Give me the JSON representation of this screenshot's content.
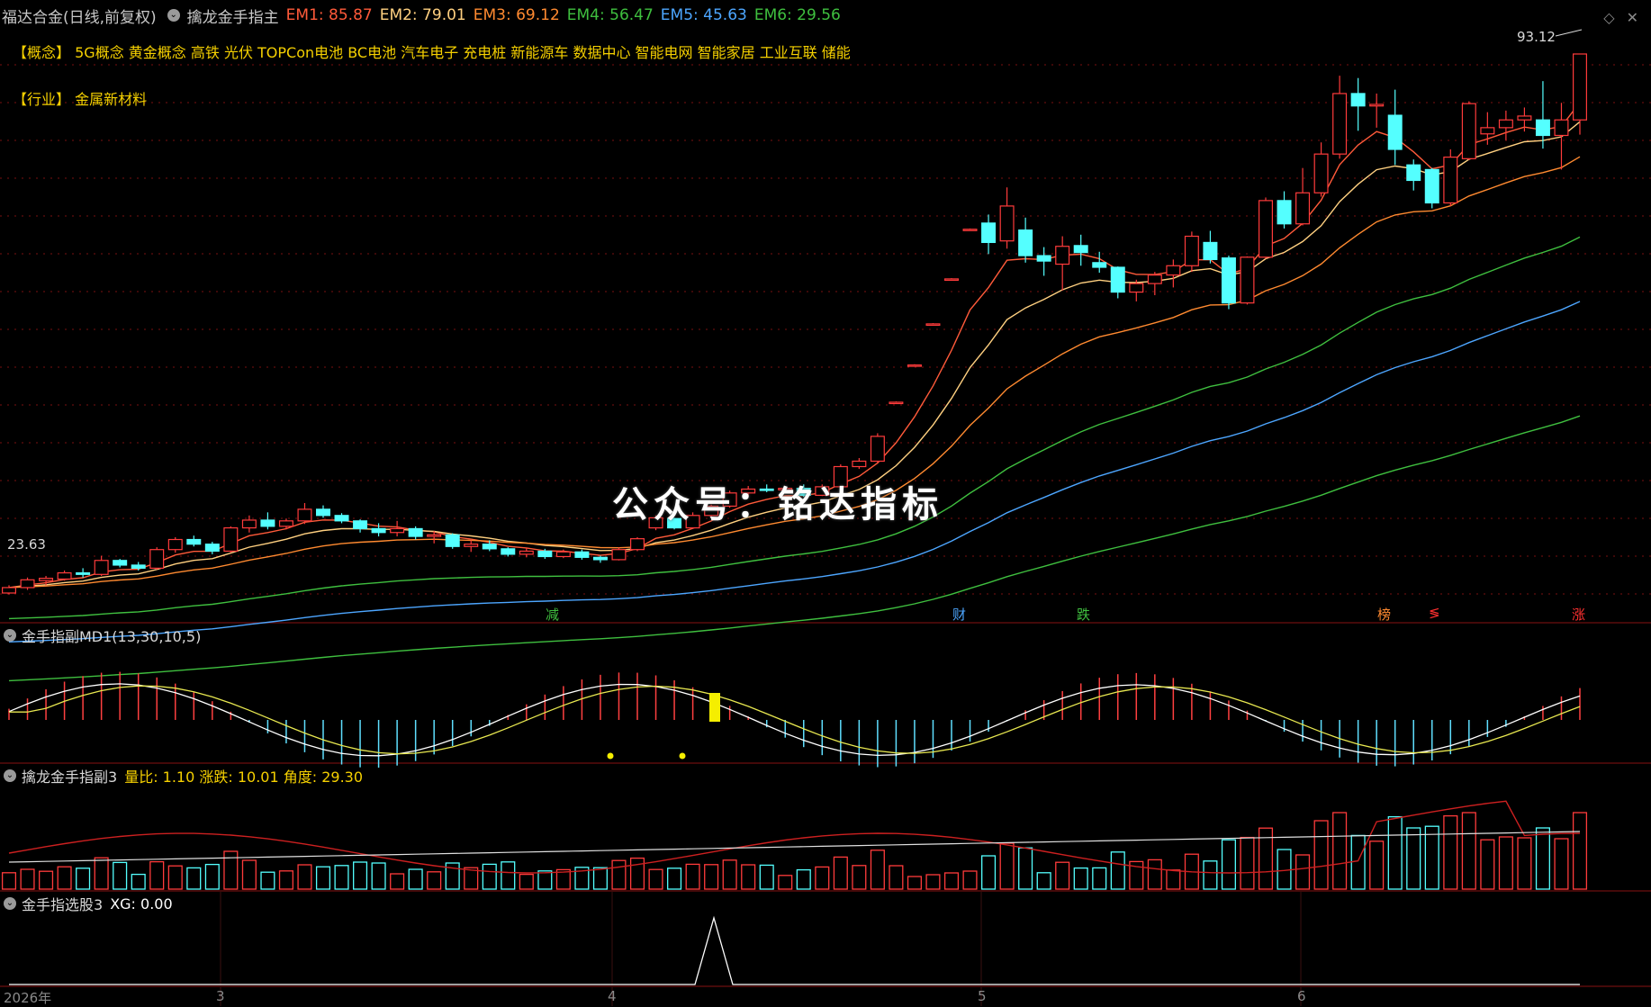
{
  "header": {
    "title": "福达合金(日线,前复权)",
    "indicator_name": "擒龙金手指主",
    "ema": [
      {
        "label": "EM1: 85.87",
        "color": "#ff5a3a"
      },
      {
        "label": "EM2: 79.01",
        "color": "#ffd080"
      },
      {
        "label": "EM3: 69.12",
        "color": "#ff8a30"
      },
      {
        "label": "EM4: 56.47",
        "color": "#3fbf3f"
      },
      {
        "label": "EM5: 45.63",
        "color": "#4da6ff"
      },
      {
        "label": "EM6: 29.56",
        "color": "#3fbf3f"
      }
    ]
  },
  "tags": {
    "concept_label": "【概念】",
    "concept_text": "5G概念 黄金概念 高铁 光伏 TOPCon电池 BC电池 汽车电子 充电桩 新能源车 数据中心 智能电网 智能家居 工业互联 储能",
    "industry_label": "【行业】",
    "industry_text": "金属新材料"
  },
  "watermark": "公众号：铭达指标",
  "panels": {
    "md1_label": "金手指副MD1(13,30,10,5)",
    "sub3_label": "擒龙金手指副3",
    "sub3_values": "量比: 1.10  涨跌: 10.01  角度: 29.30",
    "sel3_label": "金手指选股3",
    "sel3_values": "XG: 0.00"
  },
  "events": [
    {
      "text": "减",
      "color": "#3fbf3f"
    },
    {
      "text": "财",
      "color": "#4da6ff"
    },
    {
      "text": "跌",
      "color": "#3fbf3f"
    },
    {
      "text": "榜",
      "color": "#ff8a30"
    },
    {
      "text": "≶",
      "color": "#ff3030"
    },
    {
      "text": "涨",
      "color": "#ff3030"
    }
  ],
  "axis": {
    "dates": [
      "2026年",
      "3",
      "4",
      "5",
      "6"
    ]
  },
  "colors": {
    "up": "#ff3b3b",
    "down": "#54ffff",
    "grid": "#7a1010"
  },
  "chart_data": {
    "type": "candlestick",
    "max_label": "93.12",
    "min_label": "23.63",
    "ylim": [
      20,
      96
    ],
    "candles": [
      [
        23.6,
        24.6,
        23.4,
        24.3
      ],
      [
        24.3,
        25.6,
        24.0,
        25.3
      ],
      [
        25.2,
        25.8,
        24.6,
        25.5
      ],
      [
        25.4,
        26.5,
        25.2,
        26.2
      ],
      [
        26.2,
        26.8,
        25.6,
        26.0
      ],
      [
        26.0,
        28.4,
        25.8,
        27.8
      ],
      [
        27.8,
        28.0,
        26.9,
        27.2
      ],
      [
        27.2,
        27.6,
        26.5,
        26.8
      ],
      [
        26.8,
        29.5,
        26.6,
        29.2
      ],
      [
        29.2,
        30.8,
        28.8,
        30.5
      ],
      [
        30.5,
        31.0,
        29.6,
        29.9
      ],
      [
        29.9,
        30.2,
        28.6,
        29.0
      ],
      [
        29.0,
        32.2,
        28.8,
        32.0
      ],
      [
        32.0,
        33.6,
        31.4,
        33.0
      ],
      [
        33.0,
        34.0,
        31.8,
        32.2
      ],
      [
        32.2,
        33.2,
        31.8,
        32.9
      ],
      [
        32.9,
        35.2,
        32.5,
        34.4
      ],
      [
        34.4,
        34.9,
        33.3,
        33.6
      ],
      [
        33.6,
        33.9,
        32.6,
        32.9
      ],
      [
        32.9,
        33.1,
        31.4,
        31.9
      ],
      [
        31.9,
        32.6,
        30.9,
        31.4
      ],
      [
        31.4,
        32.9,
        30.9,
        31.9
      ],
      [
        31.9,
        32.2,
        30.5,
        30.9
      ],
      [
        30.9,
        31.6,
        30.0,
        31.1
      ],
      [
        31.1,
        31.3,
        29.3,
        29.6
      ],
      [
        29.6,
        30.4,
        28.9,
        29.9
      ],
      [
        29.9,
        30.4,
        29.0,
        29.3
      ],
      [
        29.3,
        29.5,
        28.3,
        28.6
      ],
      [
        28.6,
        29.4,
        28.2,
        29.0
      ],
      [
        29.0,
        29.3,
        28.0,
        28.3
      ],
      [
        28.3,
        29.2,
        28.1,
        28.9
      ],
      [
        28.9,
        29.2,
        27.9,
        28.2
      ],
      [
        28.2,
        28.4,
        27.5,
        27.9
      ],
      [
        27.9,
        29.5,
        27.8,
        29.2
      ],
      [
        29.2,
        30.8,
        29.0,
        30.6
      ],
      [
        32.0,
        33.6,
        31.7,
        33.3
      ],
      [
        33.2,
        33.3,
        31.8,
        32.0
      ],
      [
        32.0,
        34.0,
        31.9,
        33.6
      ],
      [
        33.6,
        35.0,
        33.4,
        34.8
      ],
      [
        34.8,
        36.8,
        34.6,
        36.5
      ],
      [
        36.5,
        37.4,
        36.1,
        37.0
      ],
      [
        37.0,
        37.6,
        36.6,
        36.9
      ],
      [
        36.9,
        37.4,
        36.5,
        37.1
      ],
      [
        37.1,
        37.6,
        36.0,
        36.2
      ],
      [
        36.2,
        37.6,
        36.1,
        37.3
      ],
      [
        37.3,
        40.2,
        37.1,
        39.9
      ],
      [
        39.9,
        41.0,
        39.6,
        40.6
      ],
      [
        40.6,
        44.2,
        40.4,
        43.8
      ],
      [
        48.2,
        48.3,
        48.1,
        48.2
      ],
      [
        53.0,
        53.1,
        52.9,
        53.0
      ],
      [
        58.3,
        58.4,
        58.2,
        58.3
      ],
      [
        64.1,
        64.2,
        64.0,
        64.1
      ],
      [
        70.5,
        70.6,
        70.4,
        70.5
      ],
      [
        71.3,
        72.4,
        67.3,
        68.8
      ],
      [
        69.0,
        75.9,
        68.0,
        73.5
      ],
      [
        70.4,
        72.0,
        66.2,
        67.1
      ],
      [
        67.1,
        68.2,
        64.5,
        66.4
      ],
      [
        66.0,
        69.6,
        62.6,
        68.3
      ],
      [
        68.4,
        69.8,
        65.8,
        67.5
      ],
      [
        66.2,
        67.6,
        64.9,
        65.6
      ],
      [
        65.6,
        65.7,
        61.6,
        62.4
      ],
      [
        62.4,
        64.0,
        61.2,
        63.5
      ],
      [
        63.5,
        65.0,
        62.0,
        64.6
      ],
      [
        64.6,
        66.6,
        63.0,
        65.8
      ],
      [
        65.8,
        70.2,
        65.0,
        69.6
      ],
      [
        68.8,
        70.3,
        66.1,
        66.6
      ],
      [
        66.8,
        67.1,
        60.2,
        61.0
      ],
      [
        61.0,
        67.0,
        60.8,
        66.9
      ],
      [
        66.9,
        74.6,
        66.7,
        74.2
      ],
      [
        74.2,
        75.4,
        70.6,
        71.2
      ],
      [
        71.2,
        78.4,
        71.0,
        75.2
      ],
      [
        75.2,
        81.7,
        74.7,
        80.2
      ],
      [
        80.2,
        90.3,
        79.6,
        88.0
      ],
      [
        88.0,
        90.0,
        83.2,
        86.4
      ],
      [
        86.4,
        88.0,
        83.6,
        86.6
      ],
      [
        85.2,
        88.5,
        78.8,
        80.8
      ],
      [
        78.8,
        79.5,
        75.5,
        76.8
      ],
      [
        78.2,
        78.4,
        73.2,
        73.9
      ],
      [
        73.9,
        80.8,
        73.5,
        79.8
      ],
      [
        79.6,
        87.0,
        79.4,
        86.7
      ],
      [
        82.8,
        85.6,
        81.4,
        83.6
      ],
      [
        83.6,
        85.8,
        82.0,
        84.6
      ],
      [
        84.6,
        86.2,
        83.1,
        85.1
      ],
      [
        84.6,
        89.6,
        80.9,
        82.6
      ],
      [
        82.6,
        86.8,
        78.2,
        84.6
      ],
      [
        84.6,
        93.1,
        82.7,
        93.1
      ]
    ]
  }
}
